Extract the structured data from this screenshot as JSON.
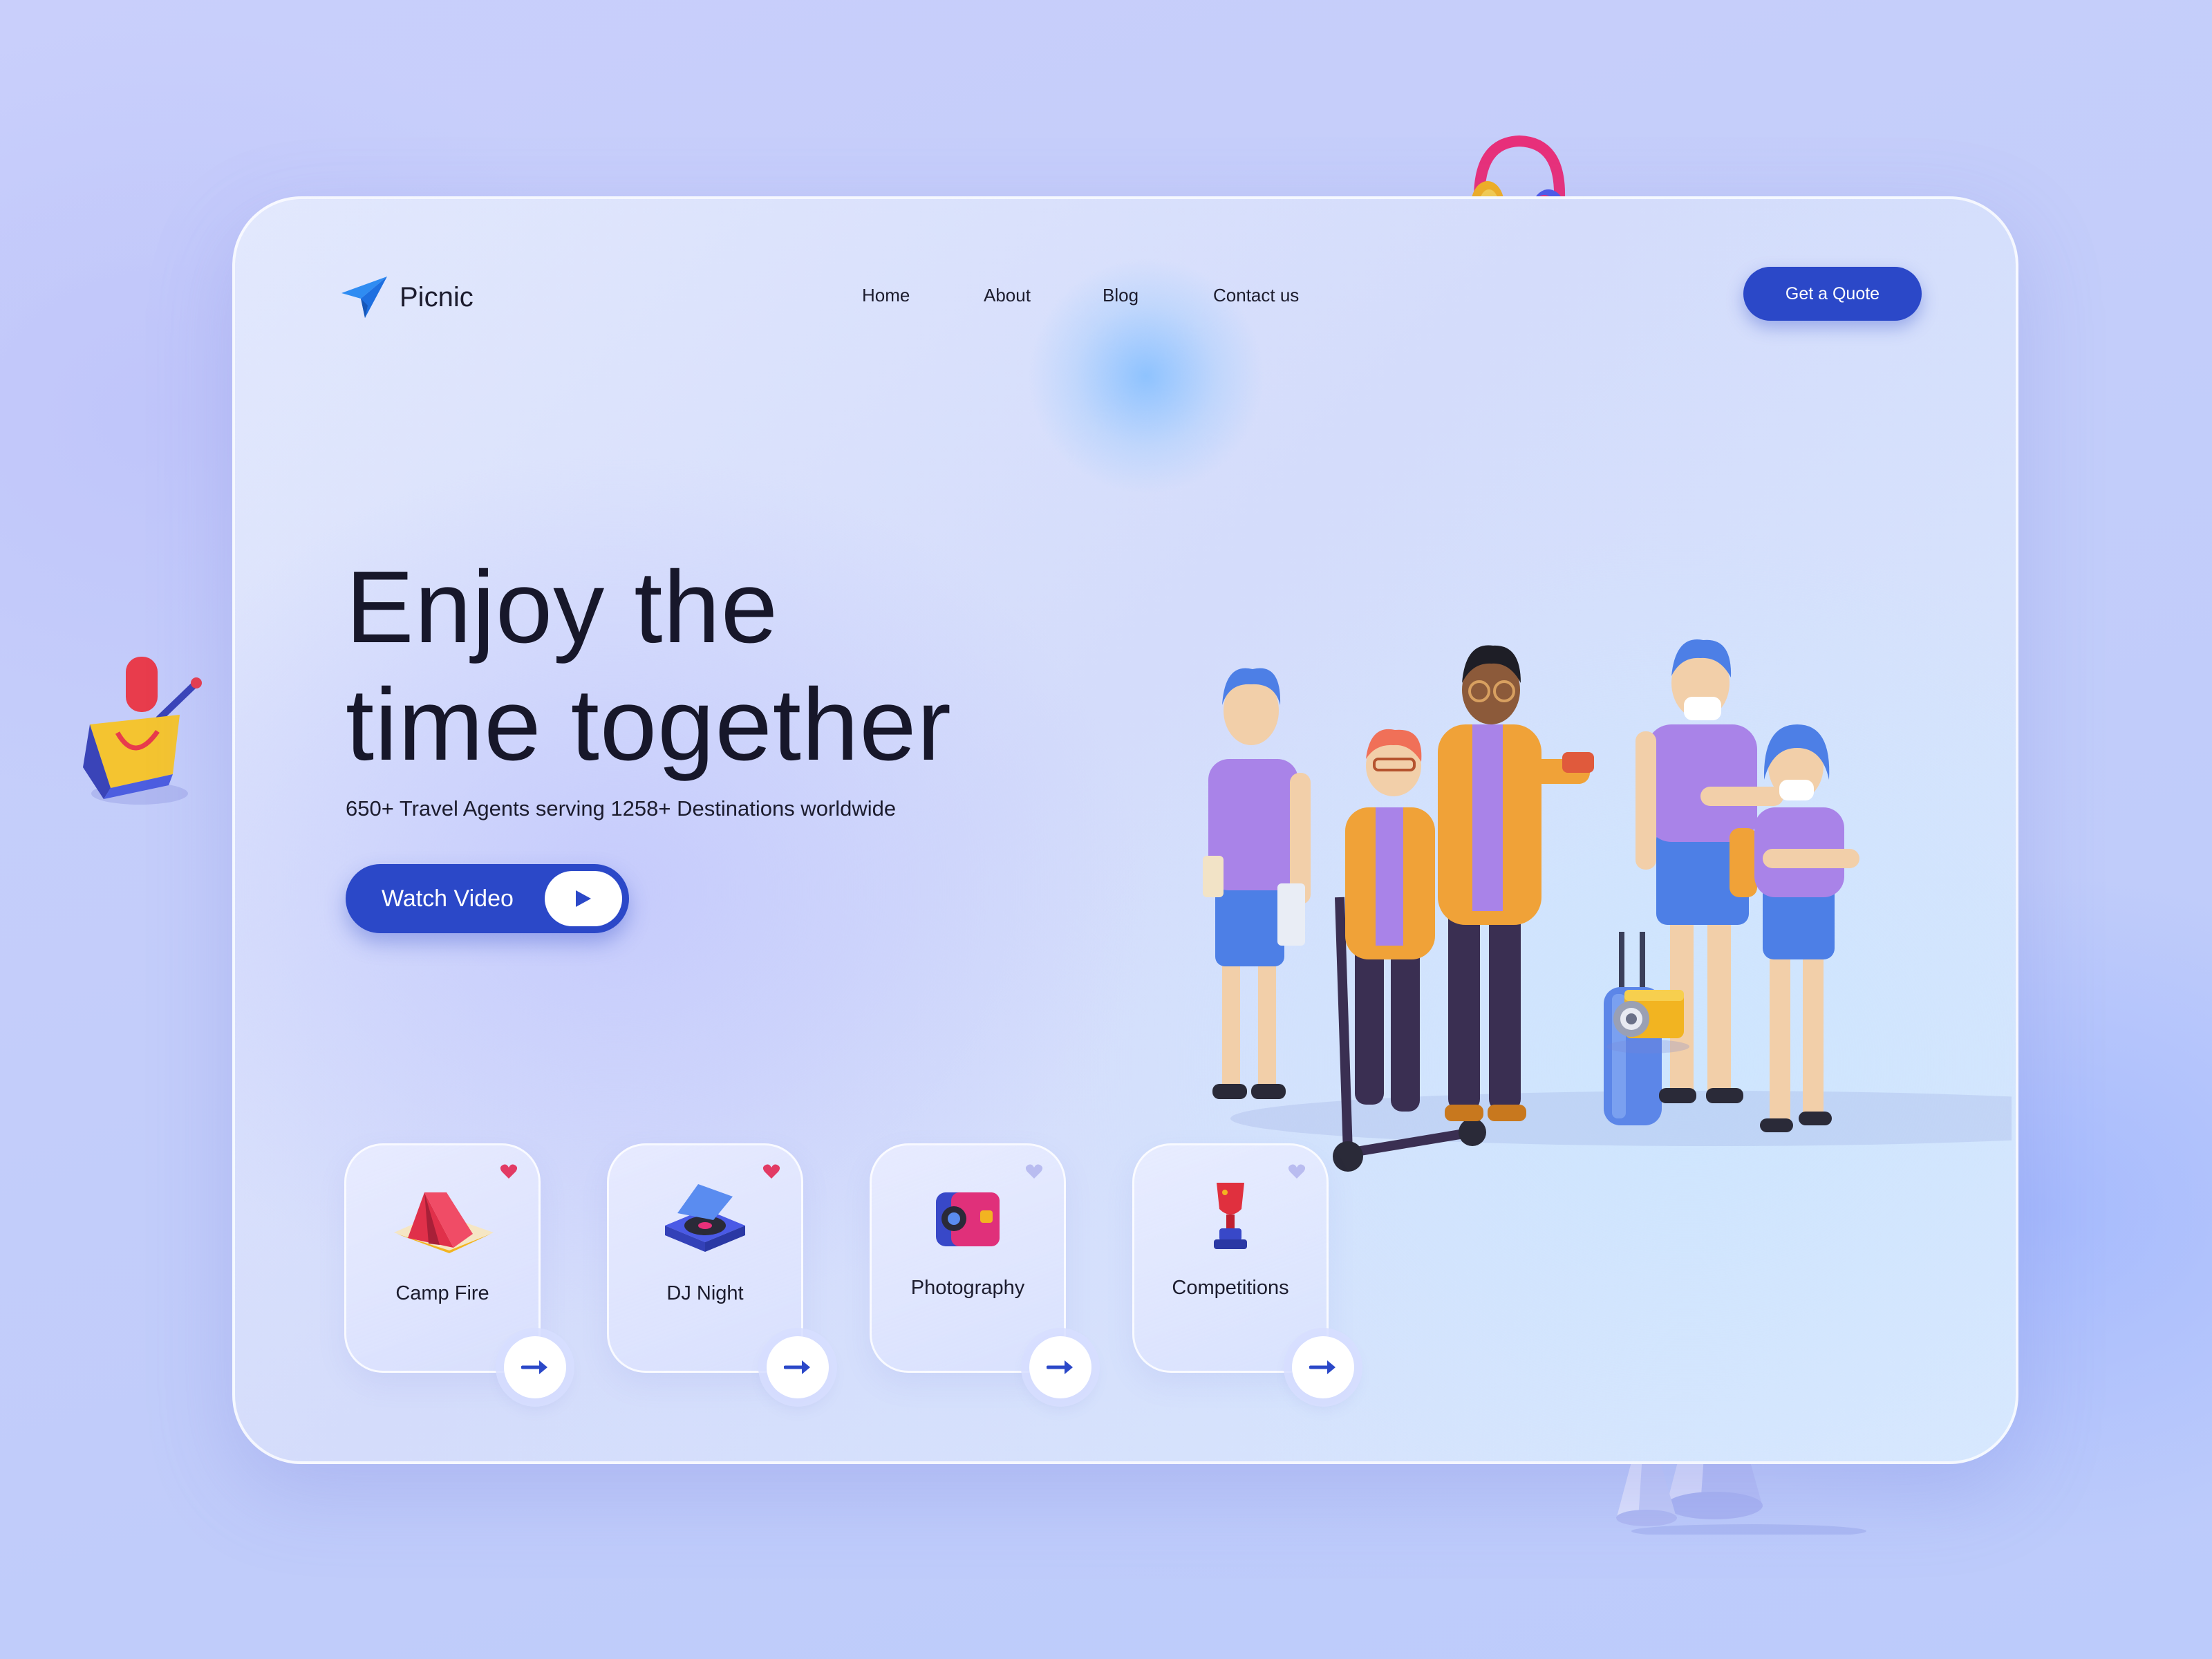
{
  "brand": {
    "name": "Picnic",
    "accent": "#2b48c8"
  },
  "nav": {
    "links": [
      "Home",
      "About",
      "Blog",
      "Contact us"
    ],
    "cta": "Get a Quote"
  },
  "hero": {
    "title_line1": "Enjoy the",
    "title_line2": "time together",
    "subtitle": "650+ Travel Agents serving 1258+ Destinations worldwide",
    "video_button": "Watch Video"
  },
  "activities": [
    {
      "label": "Camp Fire",
      "icon": "tent-icon",
      "favorited": true
    },
    {
      "label": "DJ Night",
      "icon": "turntable-icon",
      "favorited": true
    },
    {
      "label": "Photography",
      "icon": "camera-icon",
      "favorited": false
    },
    {
      "label": "Competitions",
      "icon": "trophy-icon",
      "favorited": false
    }
  ],
  "colors": {
    "heart_active": "#e23a64",
    "heart_inactive": "#b9bcf0",
    "text_dark": "#17172a"
  }
}
